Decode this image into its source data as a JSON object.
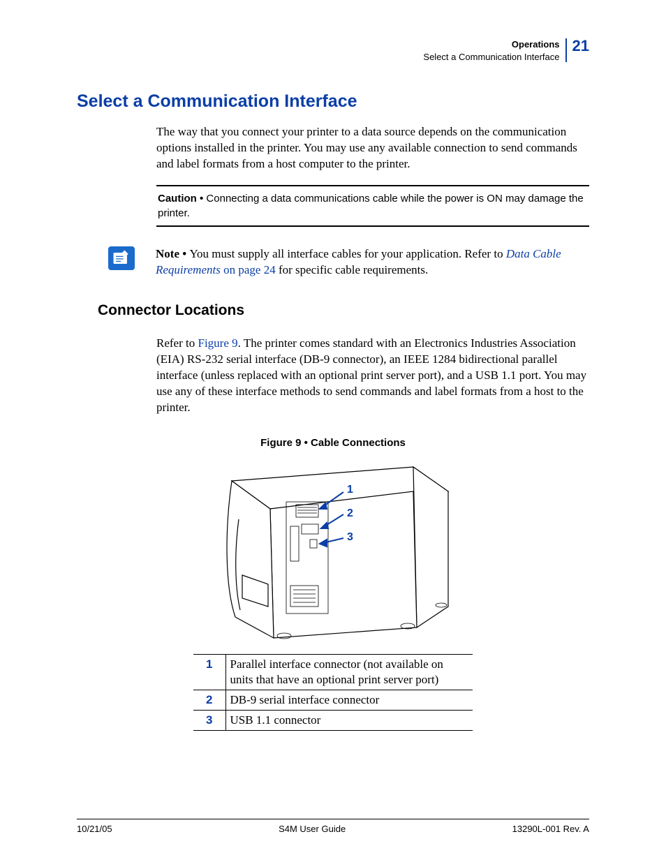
{
  "header": {
    "chapter": "Operations",
    "section": "Select a Communication Interface",
    "page_number": "21"
  },
  "h1": "Select a Communication Interface",
  "intro": "The way that you connect your printer to a data source depends on the communication options installed in the printer. You may use any available connection to send commands and label formats from a host computer to the printer.",
  "caution": {
    "label": "Caution • ",
    "text": "Connecting a data communications cable while the power is ON may damage the printer."
  },
  "note": {
    "label": "Note • ",
    "before_link": "You must supply all interface cables for your application. Refer to ",
    "link_text": "Data Cable Requirements",
    "link_tail": " on page 24",
    "after_link": " for specific cable requirements."
  },
  "h2": "Connector Locations",
  "connector_para": {
    "before_ref": "Refer to ",
    "ref": "Figure 9",
    "after_ref": ". The printer comes standard with an Electronics Industries Association (EIA) RS-232 serial interface (DB-9 connector), an IEEE 1284 bidirectional parallel interface (unless replaced with an optional print server port), and a USB 1.1 port. You may use any of these interface methods to send commands and label formats from a host to the printer."
  },
  "figure": {
    "caption": "Figure 9 • Cable Connections",
    "callouts": [
      "1",
      "2",
      "3"
    ]
  },
  "legend": [
    {
      "num": "1",
      "desc": "Parallel interface connector (not available on units that have an optional print server port)"
    },
    {
      "num": "2",
      "desc": "DB-9 serial interface connector"
    },
    {
      "num": "3",
      "desc": "USB 1.1 connector"
    }
  ],
  "footer": {
    "date": "10/21/05",
    "title": "S4M User Guide",
    "docnum": "13290L-001 Rev. A"
  }
}
